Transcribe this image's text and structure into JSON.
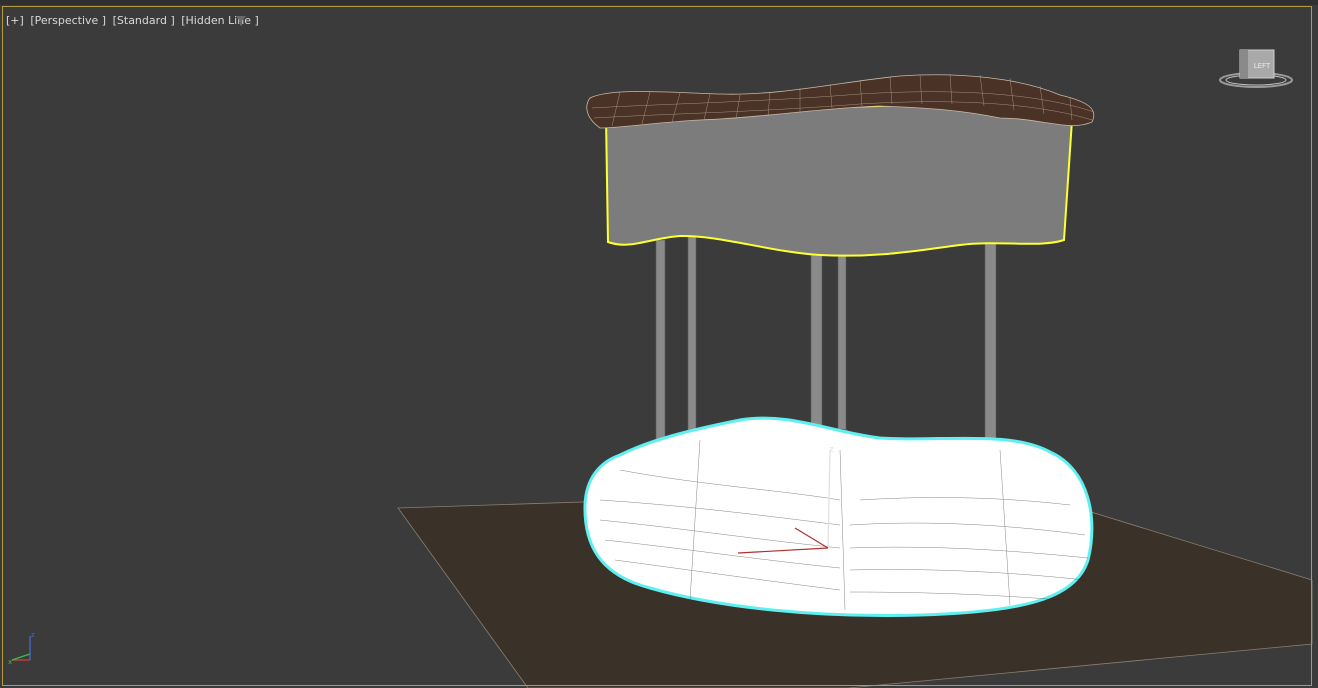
{
  "viewport": {
    "label_plus": "[+]",
    "label_view": "[Perspective ]",
    "label_shading": "[Standard ]",
    "label_style": "[Hidden Line ]"
  },
  "viewcube": {
    "face_label": "LEFT"
  },
  "axis_tripod": {
    "x": "x",
    "y": "y",
    "z": "z"
  },
  "colors": {
    "background": "#3b3b3b",
    "border_active": "#b49b3e",
    "selection_yellow": "#ffff33",
    "selection_cyan": "#5ef0f0",
    "floor": "#3a3128",
    "tabletop": "#4a3326",
    "apron": "#7a7a7a",
    "legs": "#8c8c8c"
  },
  "icons": {
    "filter": "filter-icon",
    "viewcube": "viewcube-icon",
    "axis": "axis-tripod-icon"
  }
}
